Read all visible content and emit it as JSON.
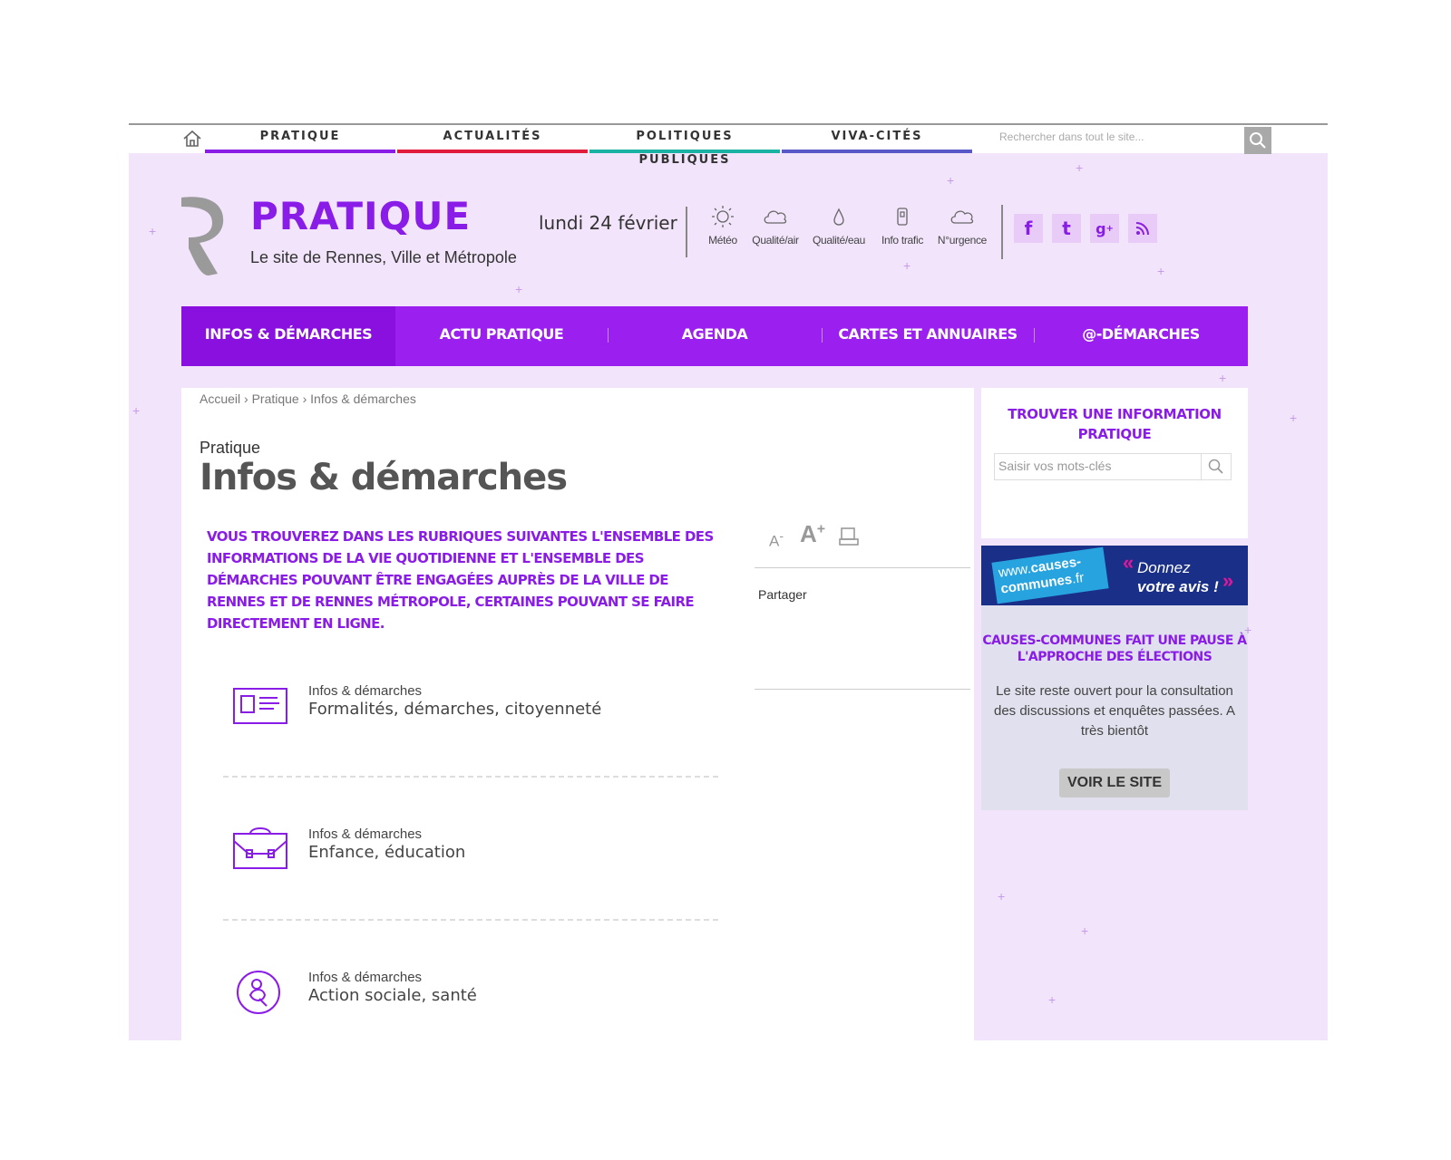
{
  "topnav": {
    "tabs": [
      {
        "label": "PRATIQUE",
        "color": "#8a1ce8"
      },
      {
        "label": "ACTUALITÉS",
        "color": "#e21b3d"
      },
      {
        "label": "POLITIQUES PUBLIQUES",
        "color": "#1ab3a3"
      },
      {
        "label": "VIVA-CITÉS",
        "color": "#5a58c9"
      }
    ],
    "search_placeholder": "Rechercher dans tout le site..."
  },
  "header": {
    "title": "PRATIQUE",
    "subtitle": "Le site de Rennes, Ville et Métropole",
    "date": "lundi 24 février",
    "widgets": [
      "Météo",
      "Qualité/air",
      "Qualité/eau",
      "Info trafic",
      "N°urgence"
    ],
    "social": [
      "facebook-icon",
      "twitter-icon",
      "google-plus-icon",
      "rss-icon"
    ]
  },
  "mainnav": {
    "items": [
      "INFOS & DÉMARCHES",
      "ACTU PRATIQUE",
      "AGENDA",
      "CARTES ET ANNUAIRES",
      "@-DÉMARCHES"
    ]
  },
  "content": {
    "breadcrumb": "Accueil › Pratique › Infos & démarches",
    "kicker": "Pratique",
    "title": "Infos & démarches",
    "intro": "VOUS TROUVEREZ DANS LES RUBRIQUES SUIVANTES L'ENSEMBLE DES INFORMATIONS DE LA VIE QUOTIDIENNE ET L'ENSEMBLE DES DÉMARCHES POUVANT ÊTRE ENGAGÉES AUPRÈS DE LA VILLE DE RENNES ET DE RENNES MÉTROPOLE, CERTAINES POUVANT SE FAIRE DIRECTEMENT EN LIGNE.",
    "tools": {
      "font_smaller": "A",
      "font_larger": "A"
    },
    "share_label": "Partager",
    "cards": [
      {
        "kicker": "Infos & démarches",
        "title": "Formalités, démarches, citoyenneté",
        "icon": "id-card-icon"
      },
      {
        "kicker": "Infos & démarches",
        "title": "Enfance, éducation",
        "icon": "school-bag-icon"
      },
      {
        "kicker": "Infos & démarches",
        "title": "Action sociale, santé",
        "icon": "social-health-icon"
      }
    ]
  },
  "sidebar": {
    "find_heading": "TROUVER UNE INFORMATION PRATIQUE",
    "find_placeholder": "Saisir vos mots-clés",
    "banner": {
      "www": "www.",
      "name": "causes-communes",
      "tld": ".fr",
      "cta_1": "Donnez",
      "cta_2": "votre avis !"
    },
    "pause_heading": "CAUSES-COMMUNES FAIT UNE PAUSE À L'APPROCHE DES ÉLECTIONS",
    "pause_text": "Le site reste ouvert pour la consultation des discussions et enquêtes passées. A très bientôt",
    "pause_button": "VOIR LE SITE"
  },
  "colors": {
    "accent": "#8a1ce8",
    "nav_bg": "#9b20f0",
    "page_bg": "#f1e4fb"
  }
}
